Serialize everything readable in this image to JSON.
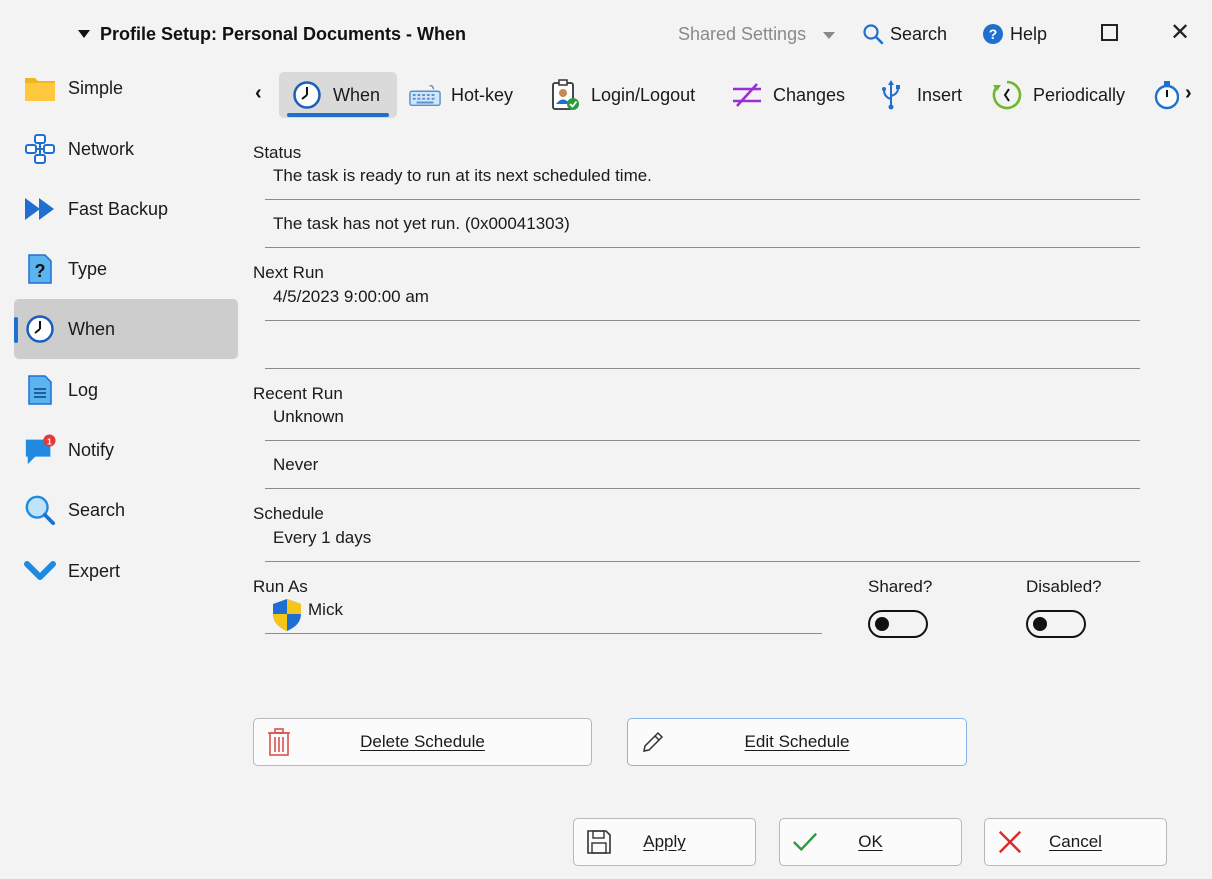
{
  "window": {
    "title": "Profile Setup: Personal Documents - When",
    "shared_settings": "Shared Settings",
    "search": "Search",
    "help": "Help"
  },
  "sidebar": {
    "items": [
      {
        "label": "Simple",
        "icon": "folder-icon"
      },
      {
        "label": "Network",
        "icon": "network-icon"
      },
      {
        "label": "Fast Backup",
        "icon": "fast-forward-icon"
      },
      {
        "label": "Type",
        "icon": "question-document-icon"
      },
      {
        "label": "When",
        "icon": "clock-icon",
        "active": true
      },
      {
        "label": "Log",
        "icon": "document-icon"
      },
      {
        "label": "Notify",
        "icon": "notification-icon",
        "badge": "1"
      },
      {
        "label": "Search",
        "icon": "magnifier-icon"
      },
      {
        "label": "Expert",
        "icon": "chevron-check-icon"
      }
    ]
  },
  "tabs": {
    "items": [
      {
        "label": "When",
        "icon": "clock-icon",
        "active": true
      },
      {
        "label": "Hot-key",
        "icon": "keyboard-icon"
      },
      {
        "label": "Login/Logout",
        "icon": "user-badge-icon"
      },
      {
        "label": "Changes",
        "icon": "changes-icon"
      },
      {
        "label": "Insert",
        "icon": "usb-icon"
      },
      {
        "label": "Periodically",
        "icon": "periodic-icon"
      }
    ]
  },
  "status": {
    "label": "Status",
    "line1": "The task is ready to run at its next scheduled time.",
    "line2": "The task has not yet run. (0x00041303)"
  },
  "next_run": {
    "label": "Next Run",
    "value": "4/5/2023 9:00:00 am",
    "value2": ""
  },
  "recent_run": {
    "label": "Recent Run",
    "line1": "Unknown",
    "line2": "Never"
  },
  "schedule": {
    "label": "Schedule",
    "value": "Every 1 days"
  },
  "run_as": {
    "label": "Run As",
    "user": "Mick"
  },
  "toggles": {
    "shared_label": "Shared?",
    "shared_on": false,
    "disabled_label": "Disabled?",
    "disabled_on": false
  },
  "buttons": {
    "delete_schedule": "Delete Schedule",
    "edit_schedule": "Edit Schedule",
    "apply": "Apply",
    "ok": "OK",
    "cancel": "Cancel"
  },
  "colors": {
    "accent": "#1f6fd1",
    "delete": "#d9534f",
    "ok": "#2e9a3e",
    "cancel": "#d92b2b",
    "changes": "#8a2be2"
  }
}
